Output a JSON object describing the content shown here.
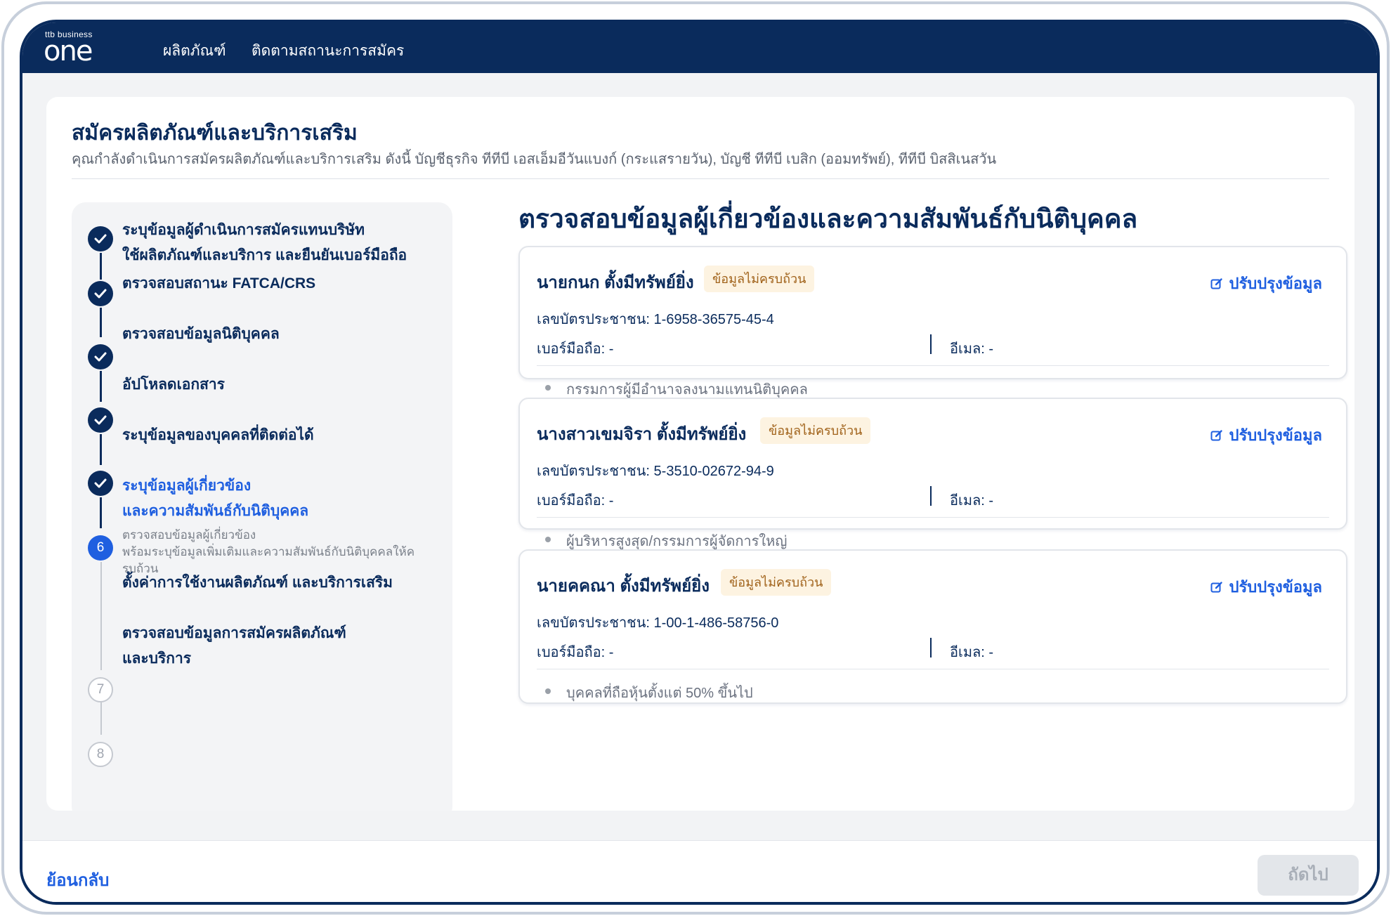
{
  "header": {
    "logo_small": "ttb business",
    "logo_big": "one",
    "nav": [
      "ผลิตภัณฑ์",
      "ติดตามสถานะการสมัคร"
    ]
  },
  "page": {
    "title": "สมัครผลิตภัณฑ์และบริการเสริม",
    "subtitle": "คุณกำลังดำเนินการสมัครผลิตภัณฑ์และบริการเสริม ดังนี้  บัญชีธุรกิจ ทีทีบี เอสเอ็มอีวันแบงก์ (กระแสรายวัน),  บัญชี ทีทีบี เบสิก (ออมทรัพย์),  ทีทีบี บิสสิเนสวัน"
  },
  "steps": [
    {
      "state": "done",
      "label_1": "ระบุข้อมูลผู้ดำเนินการสมัครแทนบริษัท",
      "label_2": "ใช้ผลิตภัณฑ์และบริการ และยืนยันเบอร์มือถือ"
    },
    {
      "state": "done",
      "label_1": "ตรวจสอบสถานะ FATCA/CRS"
    },
    {
      "state": "done",
      "label_1": "ตรวจสอบข้อมูลนิติบุคคล"
    },
    {
      "state": "done",
      "label_1": "อัปโหลดเอกสาร"
    },
    {
      "state": "done",
      "label_1": "ระบุข้อมูลของบุคคลที่ติดต่อได้"
    },
    {
      "state": "active",
      "number": "6",
      "label_1": "ระบุข้อมูลผู้เกี่ยวข้อง",
      "label_2": "และความสัมพันธ์กับนิติบุคคล",
      "desc_1": "ตรวจสอบข้อมูลผู้เกี่ยวข้อง",
      "desc_2": "พร้อมระบุข้อมูลเพิ่มเติมและความสัมพันธ์กับนิติบุคคลให้ค",
      "desc_3": "รบถ้วน"
    },
    {
      "state": "todo",
      "number": "7",
      "label_1": "ตั้งค่าการใช้งานผลิตภัณฑ์ และบริการเสริม"
    },
    {
      "state": "todo",
      "number": "8",
      "label_1": "ตรวจสอบข้อมูลการสมัครผลิตภัณฑ์",
      "label_2": "และบริการ"
    }
  ],
  "main": {
    "title": "ตรวจสอบข้อมูลผู้เกี่ยวข้องและความสัมพันธ์กับนิติบุคคล",
    "persons": [
      {
        "name": "นายกนก ตั้งมีทรัพย์ยิ่ง",
        "badge": "ข้อมูลไม่ครบถ้วน",
        "edit": "ปรับปรุงข้อมูล",
        "id": "เลขบัตรประชาชน: 1-6958-36575-45-4",
        "phone": "เบอร์มือถือ: -",
        "email": "อีเมล: -",
        "role": "กรรมการผู้มีอำนาจลงนามแทนนิติบุคคล"
      },
      {
        "name": "นางสาวเขมจิรา ตั้งมีทรัพย์ยิ่ง",
        "badge": "ข้อมูลไม่ครบถ้วน",
        "edit": "ปรับปรุงข้อมูล",
        "id": "เลขบัตรประชาชน: 5-3510-02672-94-9",
        "phone": "เบอร์มือถือ: -",
        "email": "อีเมล: -",
        "role": "ผู้บริหารสูงสุด/กรรมการผู้จัดการใหญ่"
      },
      {
        "name": "นายคคณา ตั้งมีทรัพย์ยิ่ง",
        "badge": "ข้อมูลไม่ครบถ้วน",
        "edit": "ปรับปรุงข้อมูล",
        "id": "เลขบัตรประชาชน: 1-00-1-486-58756-0",
        "phone": "เบอร์มือถือ: -",
        "email": "อีเมล: -",
        "role": "บุคคลที่ถือหุ้นตั้งแต่ 50% ขึ้นไป"
      }
    ]
  },
  "footer": {
    "back": "ย้อนกลับ",
    "next": "ถัดไป"
  },
  "colors": {
    "navy": "#0a2b5c",
    "accent": "#1f5fe0",
    "badge_bg": "#fdf3e1",
    "badge_text": "#a0621a"
  }
}
